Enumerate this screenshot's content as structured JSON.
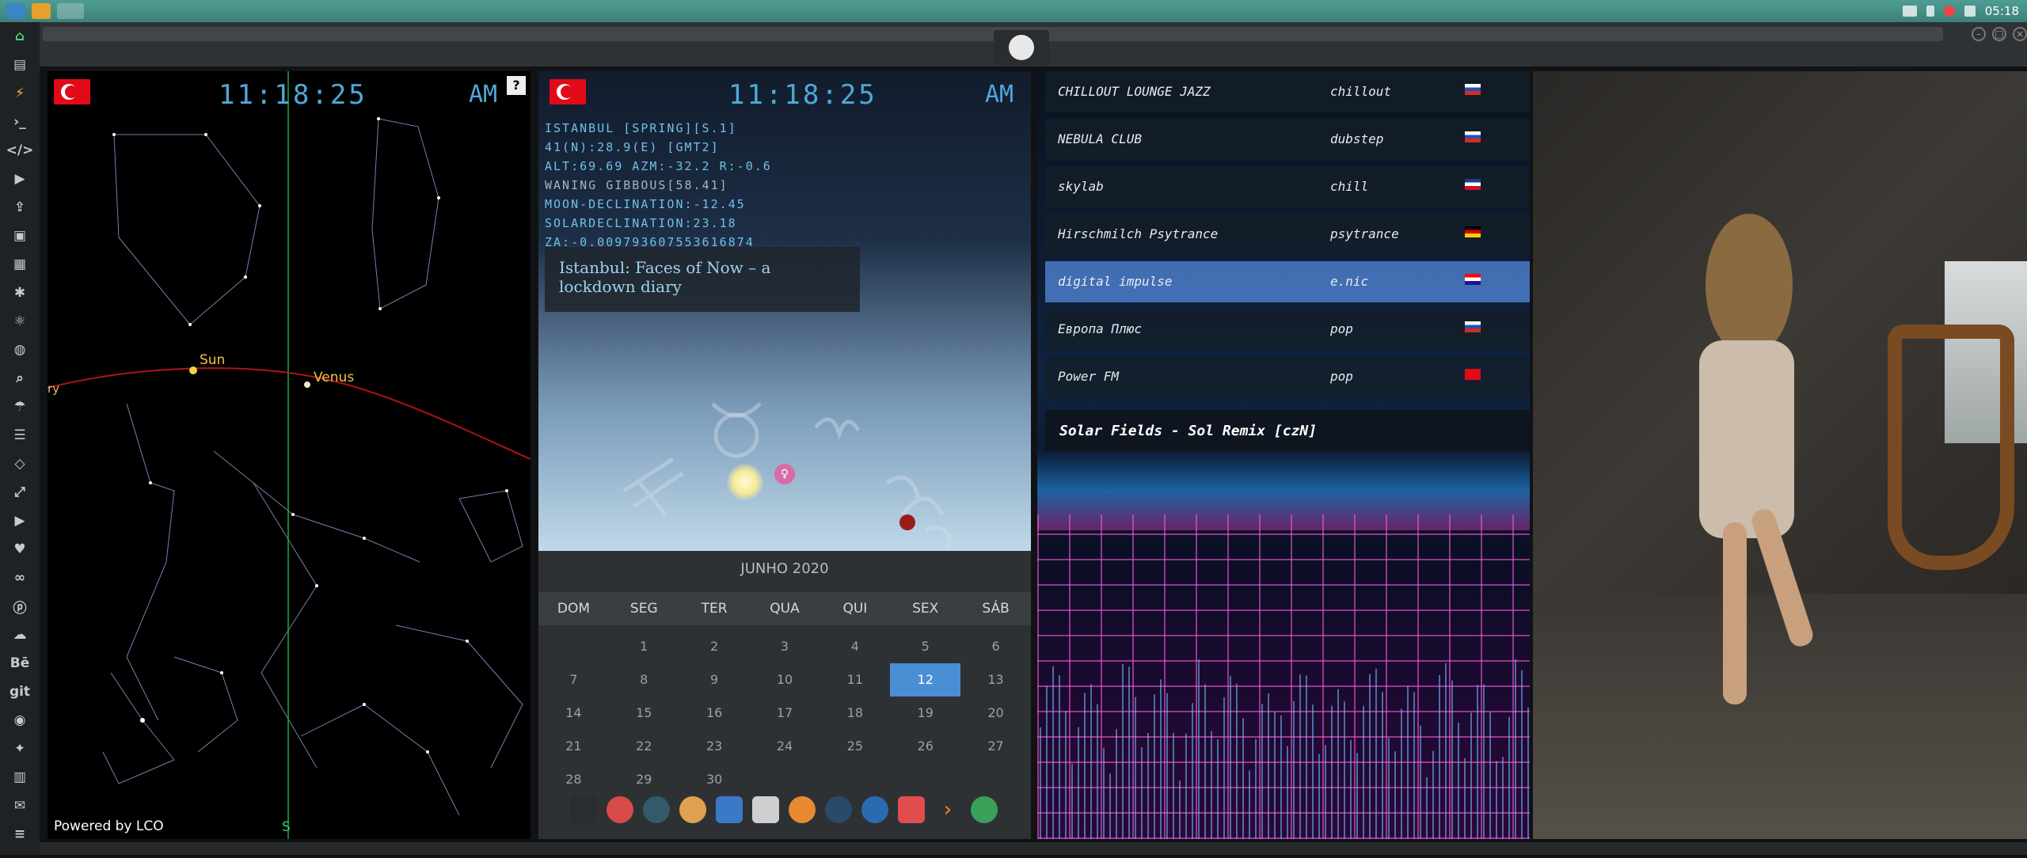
{
  "taskbar": {
    "time": "05:18"
  },
  "sidebar": {
    "items": [
      "home",
      "page",
      "bolt",
      "terminal",
      "code",
      "play",
      "share",
      "image",
      "news",
      "asterisk",
      "atom",
      "globe",
      "search",
      "umbrella",
      "contacts",
      "tag",
      "expand",
      "youtube",
      "heart",
      "loop",
      "pinterest",
      "cloud",
      "Bē",
      "git",
      "github",
      "puzzle",
      "map",
      "mail",
      "list"
    ]
  },
  "star_chart": {
    "time": "11:18:25",
    "ampm": "AM",
    "help": "?",
    "sun_label": "Sun",
    "venus_label": "Venus",
    "edge_label": "ry",
    "south_label": "S",
    "powered": "Powered by LCO"
  },
  "astro": {
    "time": "11:18:25",
    "ampm": "AM",
    "lines": [
      "ISTANBUL [SPRING][S.1]",
      "41(N):28.9(E) [GMT2]",
      "ALT:69.69 AZM:-32.2 R:-0.6",
      "WANING GIBBOUS[58.41]",
      "MOON-DECLINATION:-12.45",
      "SOLARDECLINATION:23.18",
      "ZA:-0.009793607553616874"
    ],
    "news": "Istanbul: Faces of Now – a lockdown diary"
  },
  "calendar": {
    "month": "JUNHO 2020",
    "weekdays": [
      "DOM",
      "SEG",
      "TER",
      "QUA",
      "QUI",
      "SEX",
      "SÁB"
    ],
    "days": [
      "",
      "1",
      "2",
      "3",
      "4",
      "5",
      "6",
      "7",
      "8",
      "9",
      "10",
      "11",
      "12",
      "13",
      "14",
      "15",
      "16",
      "17",
      "18",
      "19",
      "20",
      "21",
      "22",
      "23",
      "24",
      "25",
      "26",
      "27",
      "28",
      "29",
      "30",
      "",
      "",
      "",
      ""
    ],
    "today": "12"
  },
  "radio": {
    "stations": [
      {
        "name": "CHILLOUT LOUNGE JAZZ",
        "genre": "chillout",
        "flag": "ru"
      },
      {
        "name": "NEBULA CLUB",
        "genre": "dubstep",
        "flag": "ru"
      },
      {
        "name": "skylab",
        "genre": "chill",
        "flag": "gb"
      },
      {
        "name": "Hirschmilch Psytrance",
        "genre": "psytrance",
        "flag": "de"
      },
      {
        "name": "digital impulse",
        "genre": "e.nic",
        "flag": "hr"
      },
      {
        "name": "Европа Плюс",
        "genre": "pop",
        "flag": "ru"
      },
      {
        "name": "Power FM",
        "genre": "pop",
        "flag": "tr"
      }
    ],
    "selected": 4,
    "now_playing": "Solar Fields - Sol Remix [czN]"
  },
  "colors": {
    "accent": "#4ea9d8",
    "today": "#4a8fd4",
    "taskbar": "#4f9c94"
  }
}
